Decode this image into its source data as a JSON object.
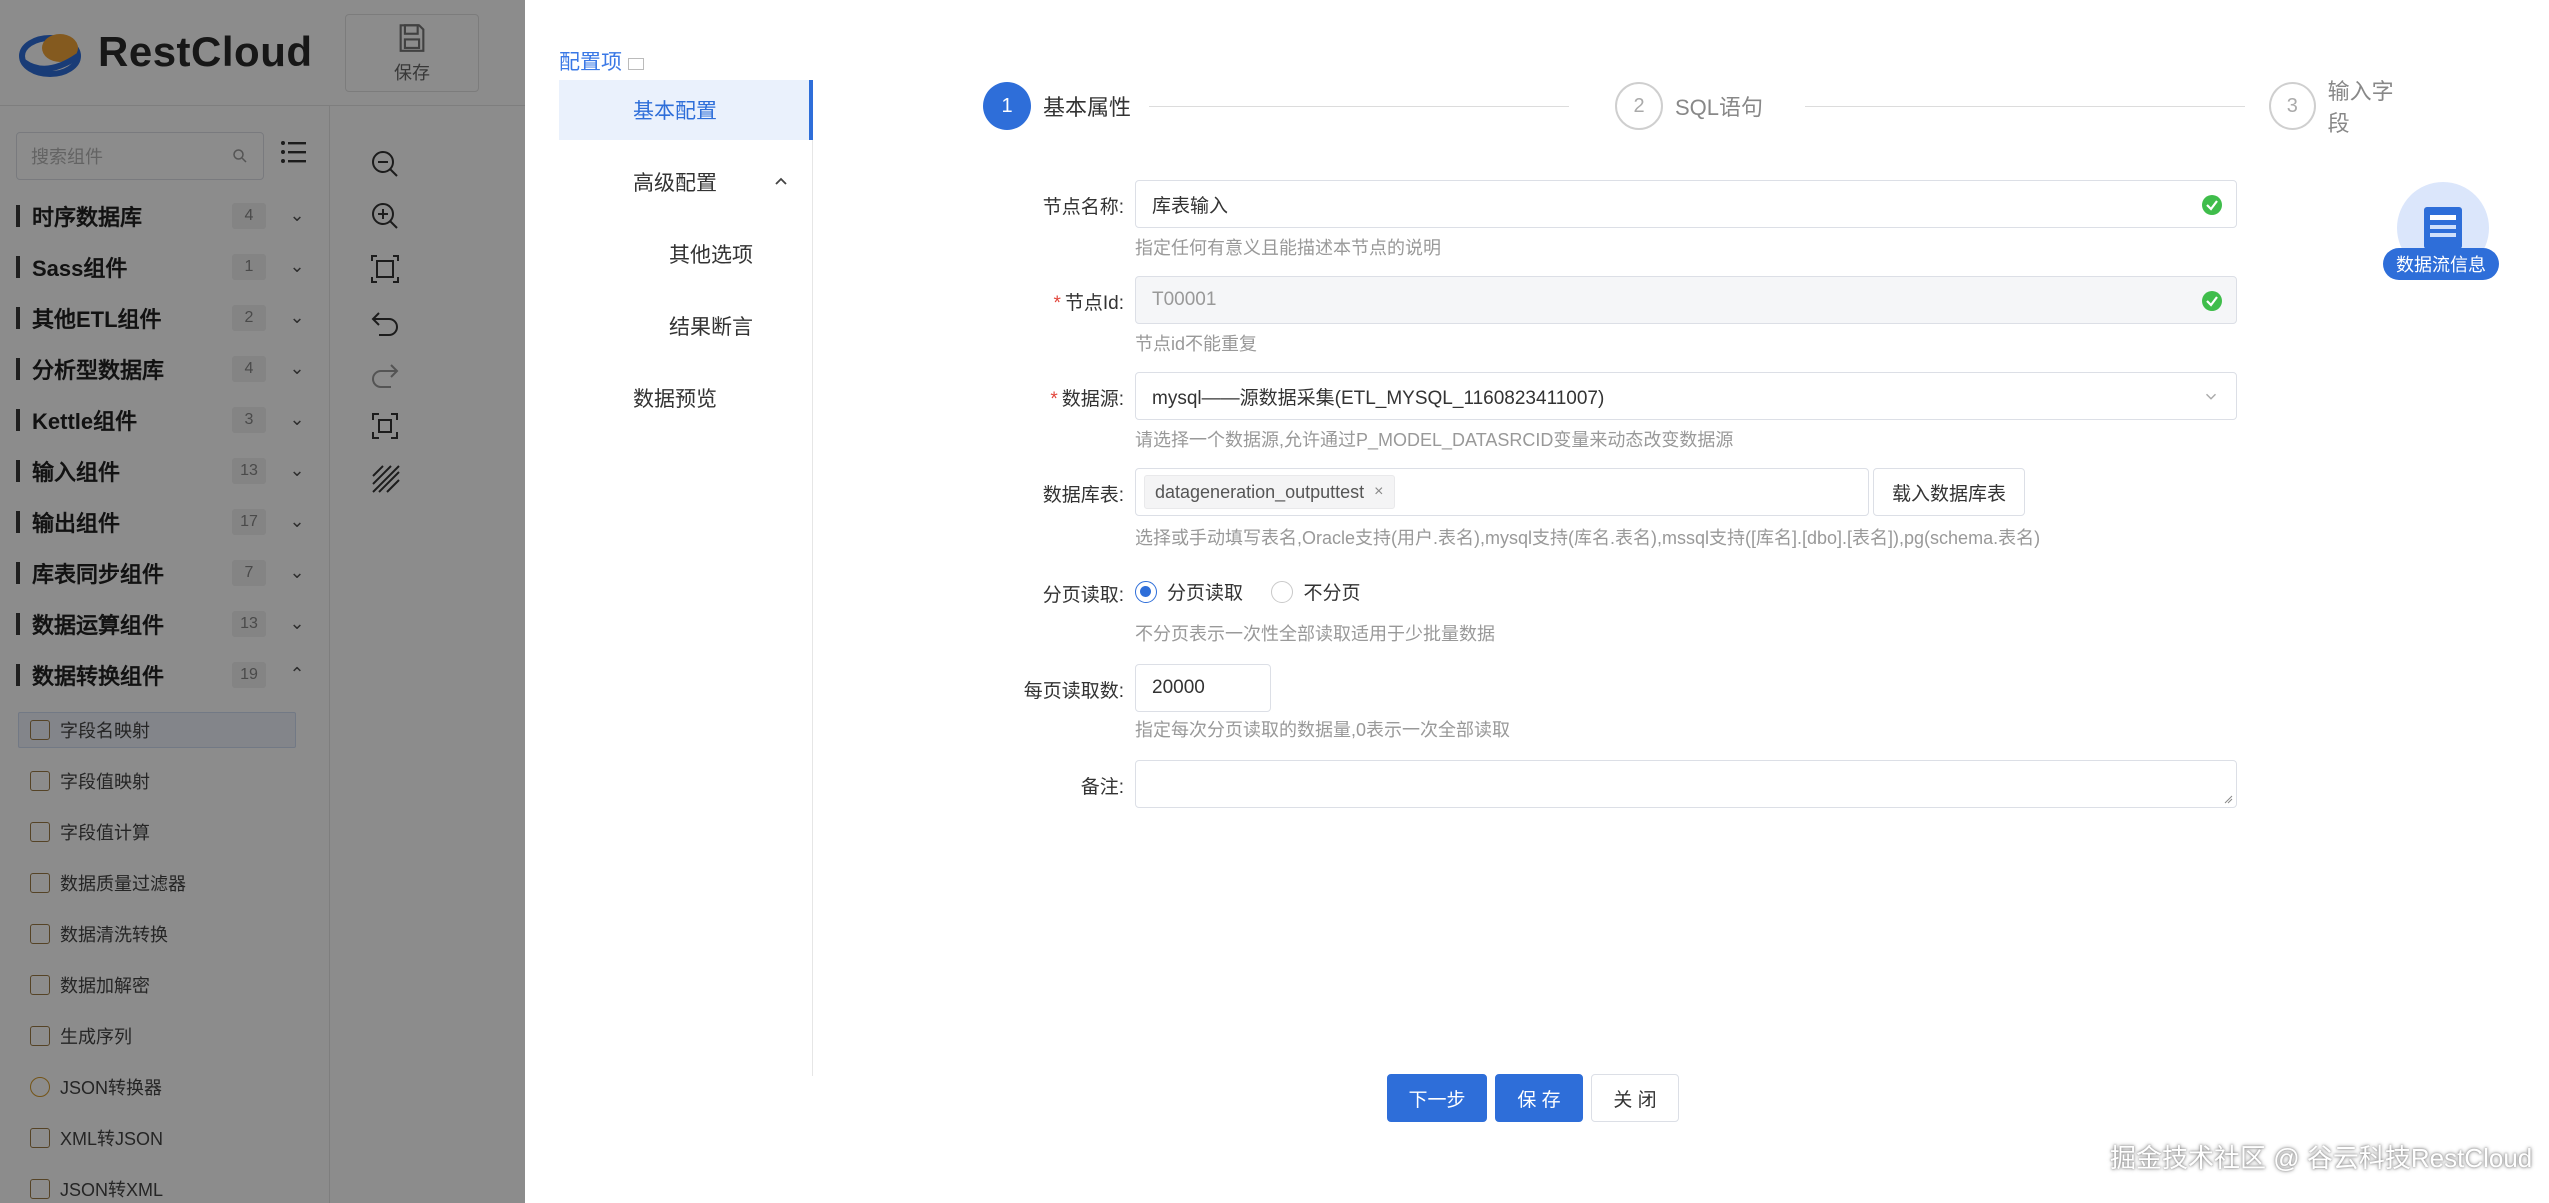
{
  "app": {
    "brand": "RestCloud",
    "toolbar_save": "保存"
  },
  "sidebar": {
    "search_placeholder": "搜索组件",
    "categories": [
      {
        "name": "时序数据库",
        "count": "4",
        "expanded": false
      },
      {
        "name": "Sass组件",
        "count": "1",
        "expanded": false
      },
      {
        "name": "其他ETL组件",
        "count": "2",
        "expanded": false
      },
      {
        "name": "分析型数据库",
        "count": "4",
        "expanded": false
      },
      {
        "name": "Kettle组件",
        "count": "3",
        "expanded": false
      },
      {
        "name": "输入组件",
        "count": "13",
        "expanded": false
      },
      {
        "name": "输出组件",
        "count": "17",
        "expanded": false
      },
      {
        "name": "库表同步组件",
        "count": "7",
        "expanded": false
      },
      {
        "name": "数据运算组件",
        "count": "13",
        "expanded": false
      },
      {
        "name": "数据转换组件",
        "count": "19",
        "expanded": true
      }
    ],
    "sub_items": [
      {
        "label": "字段名映射",
        "active": true
      },
      {
        "label": "字段值映射",
        "active": false
      },
      {
        "label": "字段值计算",
        "active": false
      },
      {
        "label": "数据质量过滤器",
        "active": false
      },
      {
        "label": "数据清洗转换",
        "active": false
      },
      {
        "label": "数据加解密",
        "active": false
      },
      {
        "label": "生成序列",
        "active": false
      },
      {
        "label": "JSON转换器",
        "active": false
      },
      {
        "label": "XML转JSON",
        "active": false
      },
      {
        "label": "JSON转XML",
        "active": false
      }
    ]
  },
  "drawer": {
    "config_title": "配置项",
    "nav": [
      {
        "label": "基本配置",
        "active": true
      },
      {
        "label": "高级配置",
        "active": false
      },
      {
        "label": "其他选项",
        "active": false
      },
      {
        "label": "结果断言",
        "active": false
      },
      {
        "label": "数据预览",
        "active": false
      }
    ],
    "steps": [
      {
        "num": "1",
        "label": "基本属性",
        "state": "active"
      },
      {
        "num": "2",
        "label": "SQL语句",
        "state": "pending"
      },
      {
        "num": "3",
        "label": "输入字段",
        "state": "pending"
      }
    ],
    "form": {
      "node_name": {
        "label": "节点名称:",
        "value": "库表输入",
        "help": "指定任何有意义且能描述本节点的说明"
      },
      "node_id": {
        "label": "节点Id:",
        "value": "T00001",
        "help": "节点id不能重复"
      },
      "datasource": {
        "label": "数据源:",
        "value": "mysql——源数据采集(ETL_MYSQL_1160823411007)",
        "help": "请选择一个数据源,允许通过P_MODEL_DATASRCID变量来动态改变数据源"
      },
      "table": {
        "label": "数据库表:",
        "tag": "datageneration_outputtest",
        "load_button": "载入数据库表",
        "help": "选择或手动填写表名,Oracle支持(用户.表名),mysql支持(库名.表名),mssql支持([库名].[dbo].[表名]),pg(schema.表名)"
      },
      "paging": {
        "label": "分页读取:",
        "option_on": "分页读取",
        "option_off": "不分页",
        "selected": "分页读取",
        "help": "不分页表示一次性全部读取适用于少批量数据"
      },
      "page_size": {
        "label": "每页读取数:",
        "value": "20000",
        "help": "指定每次分页读取的数据量,0表示一次全部读取"
      },
      "remark": {
        "label": "备注:",
        "value": ""
      }
    },
    "buttons": {
      "next": "下一步",
      "save": "保 存",
      "close": "关 闭"
    },
    "flow_badge": "数据流信息"
  },
  "watermark": "掘金技术社区 @ 谷云科技RestCloud",
  "colors": {
    "primary": "#2e6ed9",
    "success": "#3fbd4b",
    "required": "#e2463c"
  }
}
